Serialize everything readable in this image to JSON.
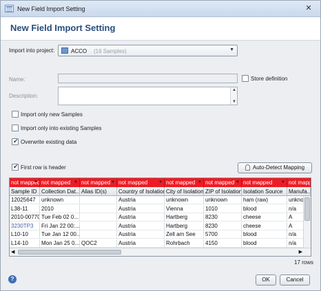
{
  "window": {
    "title": "New Field Import Setting",
    "close_glyph": "✕"
  },
  "header": {
    "title": "New Field Import Setting"
  },
  "project": {
    "label": "Import into project:",
    "value": "ACCO",
    "count": "(16 Samples)",
    "icon": "project-icon"
  },
  "name": {
    "label": "Name:"
  },
  "store": {
    "label": "Store definition",
    "checked": false
  },
  "description": {
    "label": "Description:"
  },
  "options": [
    {
      "label": "Import only new Samples",
      "checked": false
    },
    {
      "label": "Import only into existing Samples",
      "checked": false
    },
    {
      "label": "Overwrite existing data",
      "checked": true
    }
  ],
  "first_row": {
    "label": "First row is header",
    "checked": true
  },
  "auto_detect": {
    "label": "Auto-Detect Mapping",
    "icon": "lightbulb-icon"
  },
  "grid": {
    "mapping": [
      "not mapped",
      "not mapped",
      "not mapped",
      "not mapped",
      "not mapped",
      "not mapped",
      "not mapped",
      "not mapped"
    ],
    "headers": [
      "Sample ID",
      "Collection Dat...",
      "Alias ID(s)",
      "Country of Isolation",
      "City of Isolation",
      "ZIP of Isolation",
      "Isolation Source",
      "Manufa..."
    ],
    "rows": [
      [
        "12025647",
        "unknown",
        "",
        "Austria",
        "unknown",
        "unknown",
        "ham (raw)",
        "unknow"
      ],
      [
        "L38-11",
        "2010",
        "",
        "Austria",
        "Vienna",
        "1010",
        "blood",
        "n/a"
      ],
      [
        "2010-00770",
        "Tue Feb 02 0...",
        "",
        "Austria",
        "Hartberg",
        "8230",
        "cheese",
        "A"
      ],
      [
        "3230TP3",
        "Fri Jan 22 00:...",
        "",
        "Austria",
        "Hartberg",
        "8230",
        "cheese",
        "A"
      ],
      [
        "L10-10",
        "Tue Jan 12 00...",
        "",
        "Austria",
        "Zell am See",
        "5700",
        "blood",
        "n/a"
      ],
      [
        "L14-10",
        "Mon Jan 25 0...",
        "QOC2",
        "Austria",
        "Rohrbach",
        "4150",
        "blood",
        "n/a"
      ]
    ]
  },
  "row_count": "17 rows",
  "buttons": {
    "ok": "OK",
    "cancel": "Cancel"
  },
  "help": {
    "glyph": "?"
  }
}
